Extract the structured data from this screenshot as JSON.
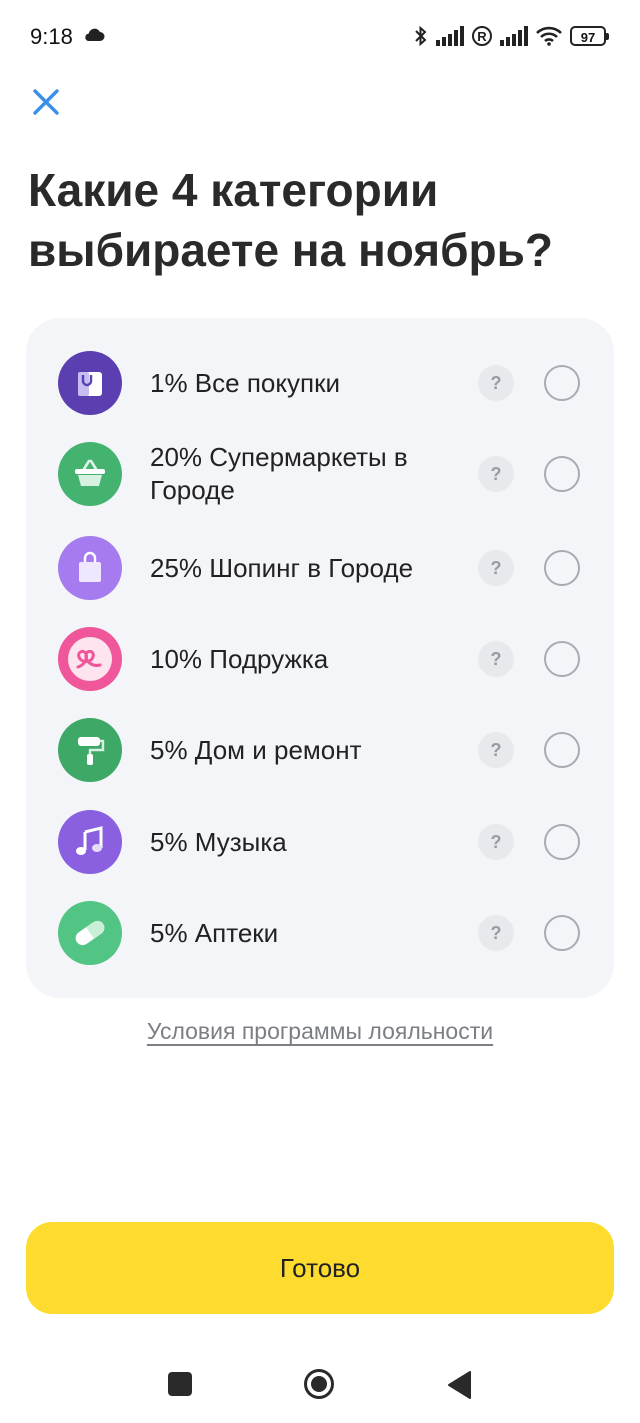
{
  "status_bar": {
    "time": "9:18",
    "battery": "97",
    "r_mark": "R"
  },
  "title": "Какие 4 категории выбираете на ноябрь?",
  "categories": [
    {
      "label": "1% Все покупки",
      "icon": "shopping-bag-icon",
      "color": "#5b3fb0"
    },
    {
      "label": "20% Супермаркеты в Городе",
      "icon": "basket-icon",
      "color": "#44b36f"
    },
    {
      "label": "25% Шопинг в Городе",
      "icon": "bag-icon",
      "color": "#a77bf0"
    },
    {
      "label": "10% Подружка",
      "icon": "podruzhka-logo-icon",
      "color": "#f0579a"
    },
    {
      "label": "5% Дом и ремонт",
      "icon": "paint-roller-icon",
      "color": "#3ea866"
    },
    {
      "label": "5% Музыка",
      "icon": "music-note-icon",
      "color": "#8a5fe0"
    },
    {
      "label": "5% Аптеки",
      "icon": "pill-icon",
      "color": "#52c483"
    }
  ],
  "help_label": "?",
  "loyalty_link": "Условия программы лояльности",
  "done_label": "Готово",
  "colors": {
    "accent": "#fedc2f",
    "close": "#3a8fe8",
    "card_bg": "#f4f5f8"
  }
}
